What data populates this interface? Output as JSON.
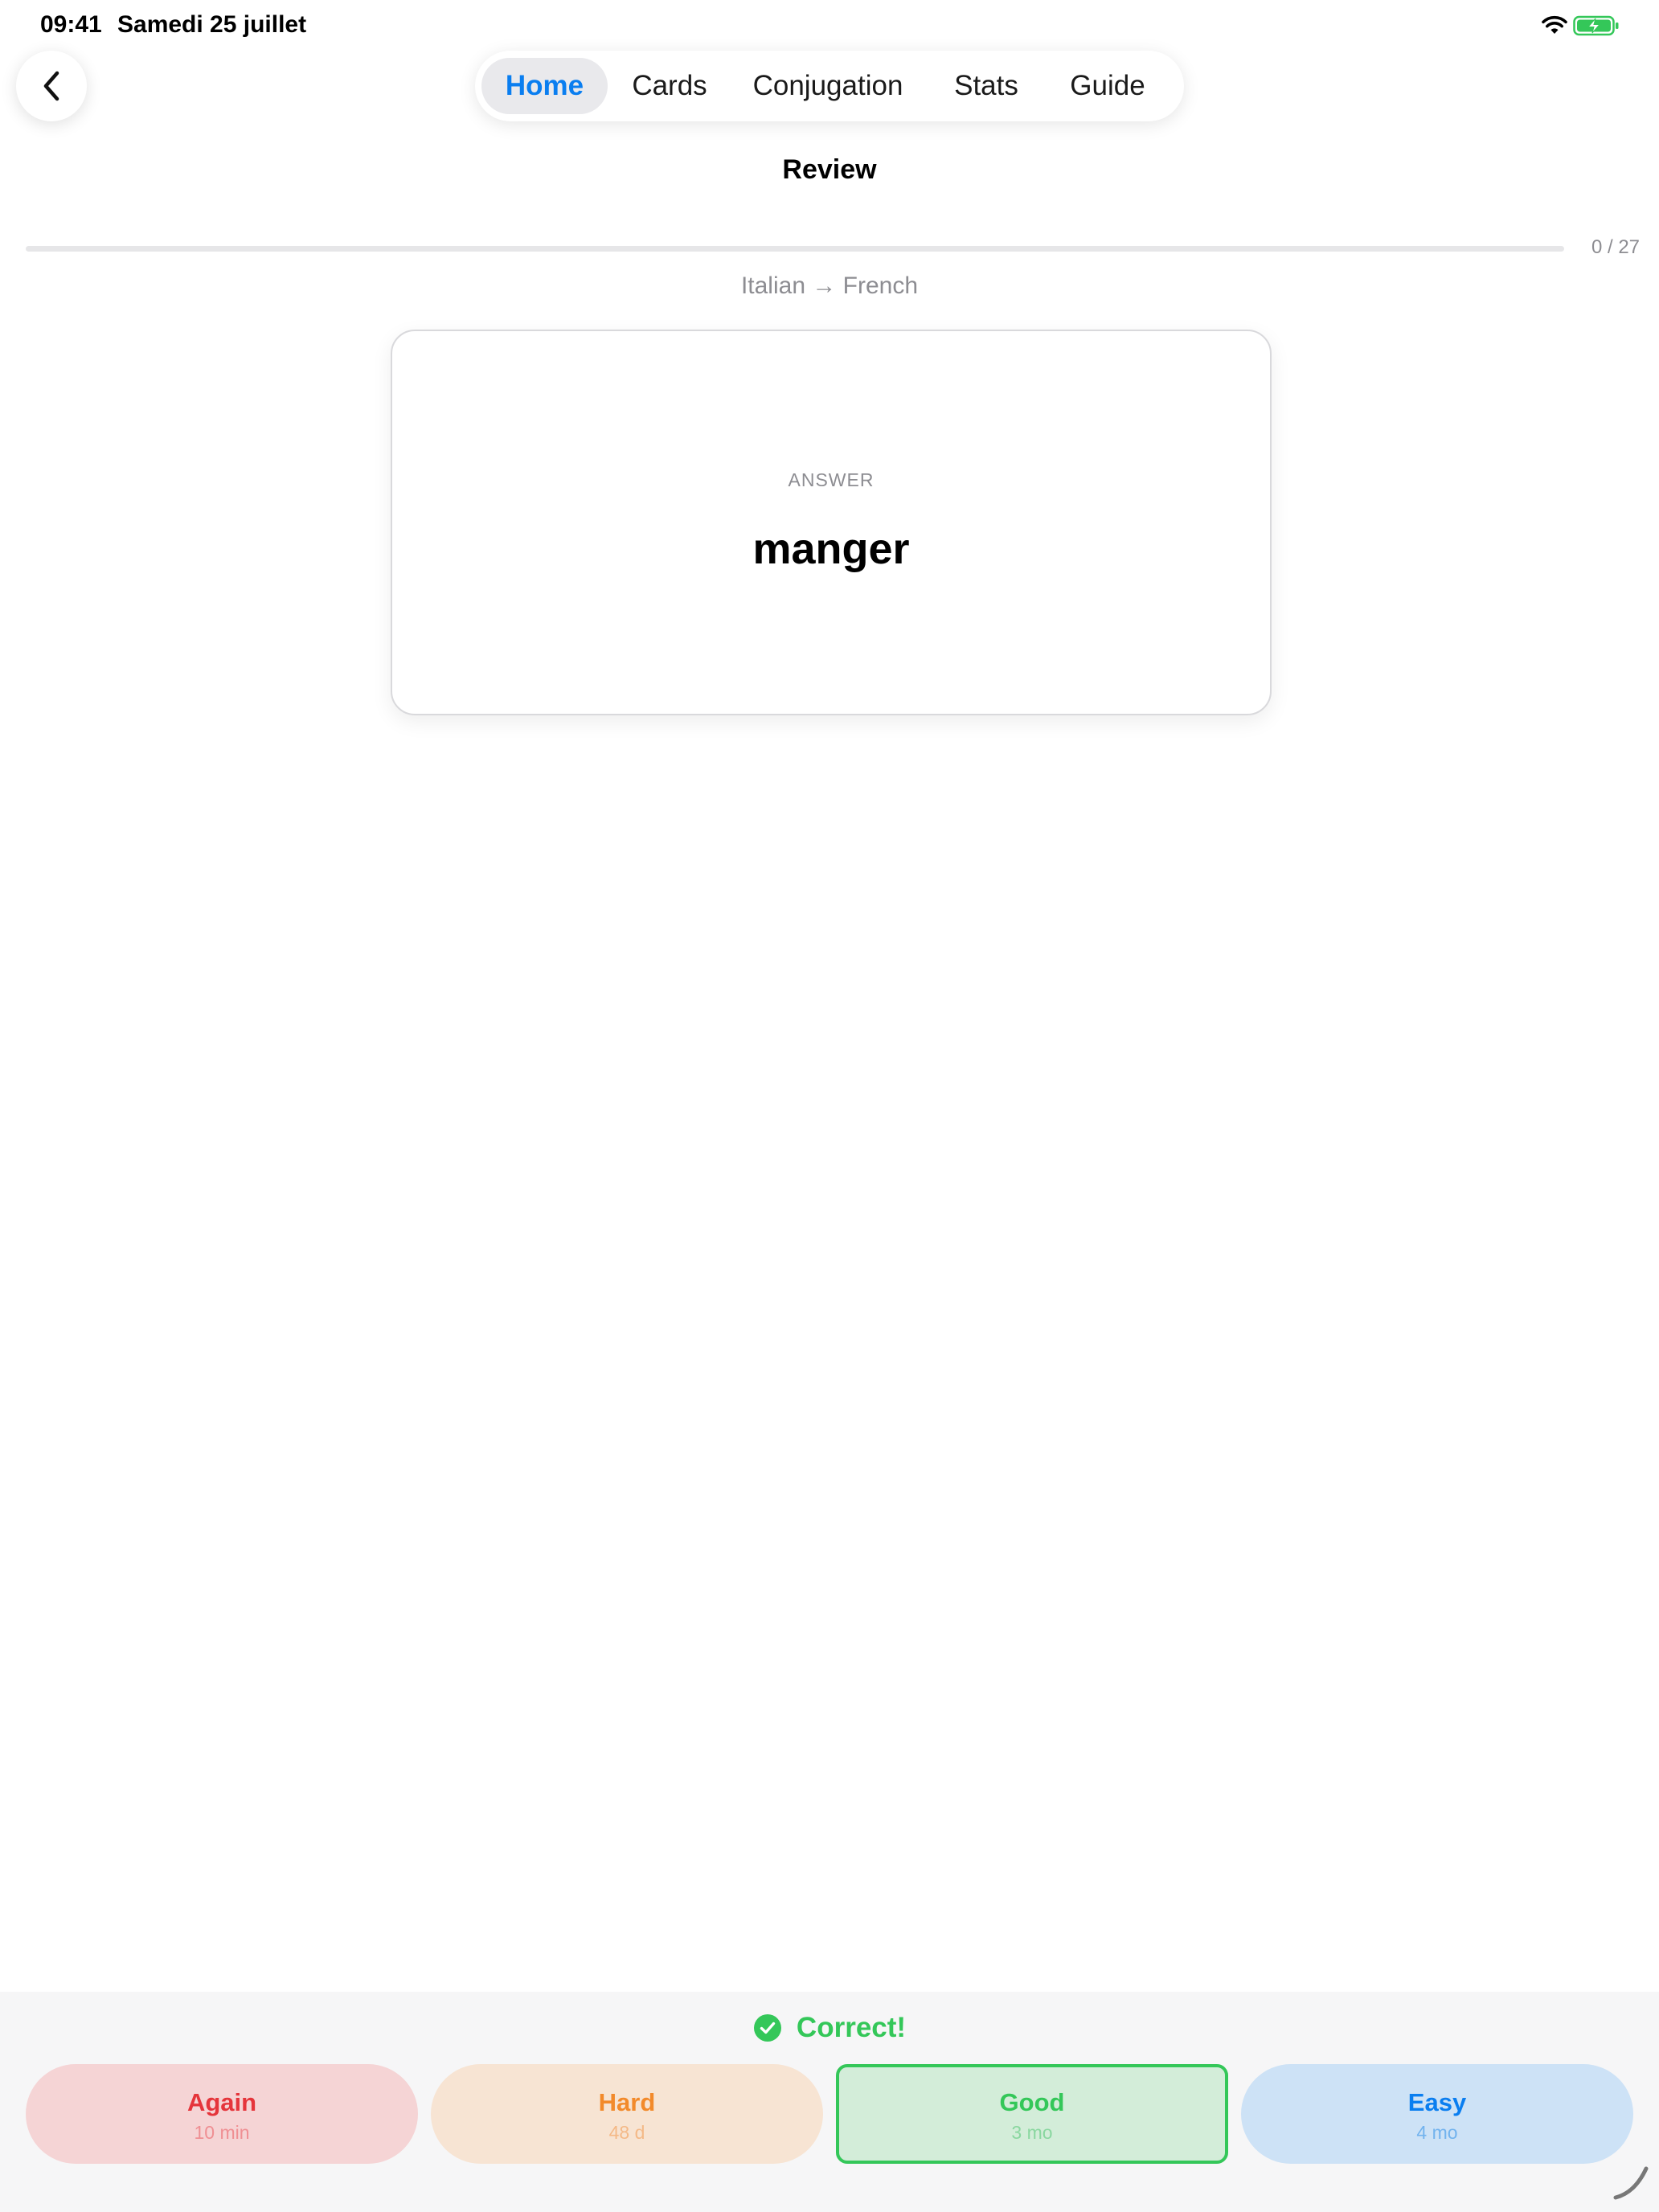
{
  "status_bar": {
    "time": "09:41",
    "date": "Samedi 25 juillet",
    "icons": [
      "wifi-icon",
      "battery-charging-icon"
    ]
  },
  "nav": {
    "back_icon": "chevron-left-icon",
    "tabs": [
      {
        "label": "Home",
        "active": true
      },
      {
        "label": "Cards",
        "active": false
      },
      {
        "label": "Conjugation",
        "active": false
      },
      {
        "label": "Stats",
        "active": false
      },
      {
        "label": "Guide",
        "active": false
      }
    ]
  },
  "page": {
    "title": "Review",
    "progress": {
      "current": 0,
      "total": 27,
      "text": "0 / 27"
    },
    "direction": "Italian → French"
  },
  "card": {
    "label": "ANSWER",
    "word": "manger"
  },
  "feedback": {
    "icon": "checkmark-circle-icon",
    "text": "Correct!"
  },
  "grades": [
    {
      "label": "Again",
      "interval": "10 min",
      "color": "#e5353b"
    },
    {
      "label": "Hard",
      "interval": "48 d",
      "color": "#f28a2b"
    },
    {
      "label": "Good",
      "interval": "3 mo",
      "color": "#34c759",
      "selected": true
    },
    {
      "label": "Easy",
      "interval": "4 mo",
      "color": "#0a7ef0"
    }
  ],
  "colors": {
    "accent": "#0a7ef0",
    "success": "#34c759",
    "muted_text": "#8d8d92"
  }
}
